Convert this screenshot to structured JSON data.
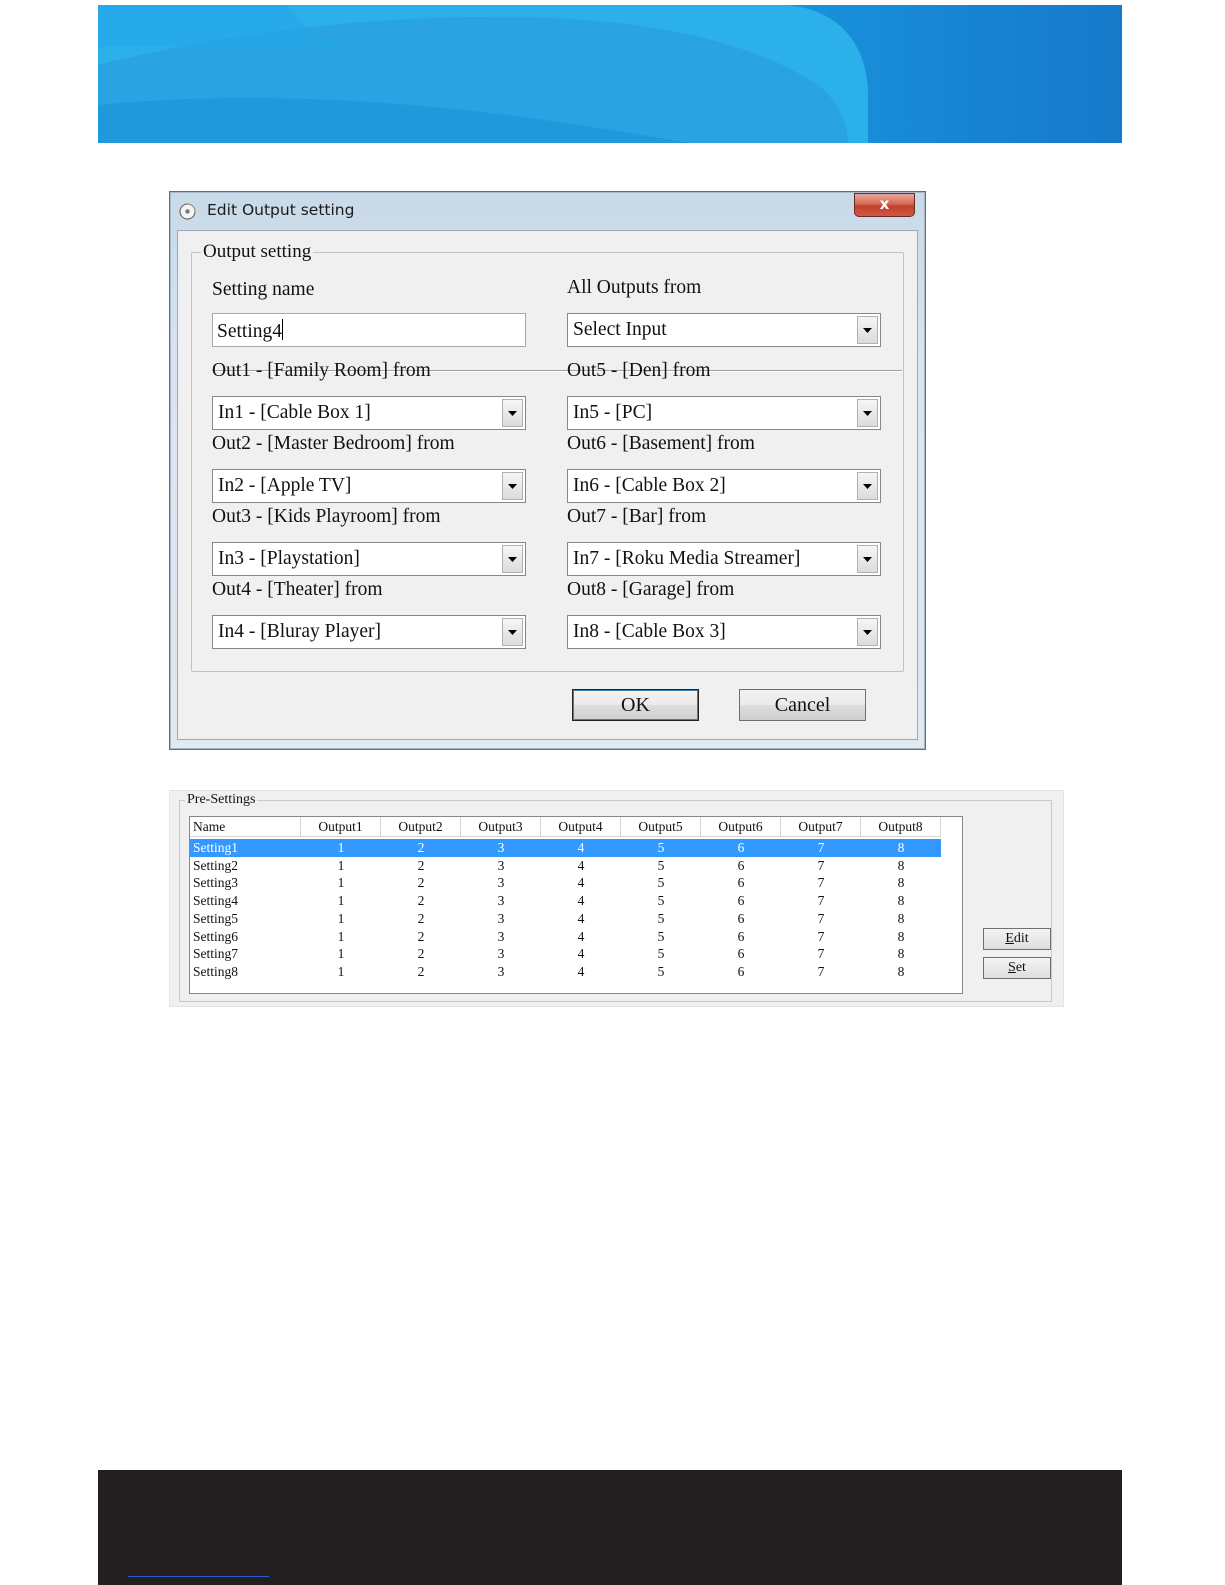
{
  "dialog": {
    "title": "Edit Output setting",
    "close_label": "x",
    "group_title": "Output setting",
    "setting_name_label": "Setting name",
    "setting_name_value": "Setting4",
    "all_outputs_label": "All Outputs from",
    "all_outputs_value": "Select Input",
    "outputs": [
      {
        "label": "Out1 - [Family Room] from",
        "value": "In1 - [Cable Box 1]"
      },
      {
        "label": "Out2 - [Master Bedroom] from",
        "value": "In2 - [Apple TV]"
      },
      {
        "label": "Out3 - [Kids Playroom] from",
        "value": "In3 - [Playstation]"
      },
      {
        "label": "Out4 - [Theater] from",
        "value": "In4 - [Bluray Player]"
      },
      {
        "label": "Out5 - [Den] from",
        "value": "In5 - [PC]"
      },
      {
        "label": "Out6 - [Basement] from",
        "value": "In6 - [Cable Box 2]"
      },
      {
        "label": "Out7 - [Bar] from",
        "value": "In7 - [Roku Media Streamer]"
      },
      {
        "label": "Out8 - [Garage] from",
        "value": "In8 - [Cable Box 3]"
      }
    ],
    "ok_label": "OK",
    "cancel_label": "Cancel"
  },
  "presettings": {
    "title": "Pre-Settings",
    "columns": [
      "Name",
      "Output1",
      "Output2",
      "Output3",
      "Output4",
      "Output5",
      "Output6",
      "Output7",
      "Output8"
    ],
    "rows": [
      [
        "Setting1",
        "1",
        "2",
        "3",
        "4",
        "5",
        "6",
        "7",
        "8"
      ],
      [
        "Setting2",
        "1",
        "2",
        "3",
        "4",
        "5",
        "6",
        "7",
        "8"
      ],
      [
        "Setting3",
        "1",
        "2",
        "3",
        "4",
        "5",
        "6",
        "7",
        "8"
      ],
      [
        "Setting4",
        "1",
        "2",
        "3",
        "4",
        "5",
        "6",
        "7",
        "8"
      ],
      [
        "Setting5",
        "1",
        "2",
        "3",
        "4",
        "5",
        "6",
        "7",
        "8"
      ],
      [
        "Setting6",
        "1",
        "2",
        "3",
        "4",
        "5",
        "6",
        "7",
        "8"
      ],
      [
        "Setting7",
        "1",
        "2",
        "3",
        "4",
        "5",
        "6",
        "7",
        "8"
      ],
      [
        "Setting8",
        "1",
        "2",
        "3",
        "4",
        "5",
        "6",
        "7",
        "8"
      ]
    ],
    "selected_row": 0,
    "edit_label_underlined": "E",
    "edit_label_rest": "dit",
    "set_label_underlined": "S",
    "set_label_rest": "et"
  },
  "colors": {
    "banner_primary": "#1e9be0",
    "banner_light": "#3fbcec",
    "selection": "#3399ff",
    "footer": "#231f20"
  }
}
